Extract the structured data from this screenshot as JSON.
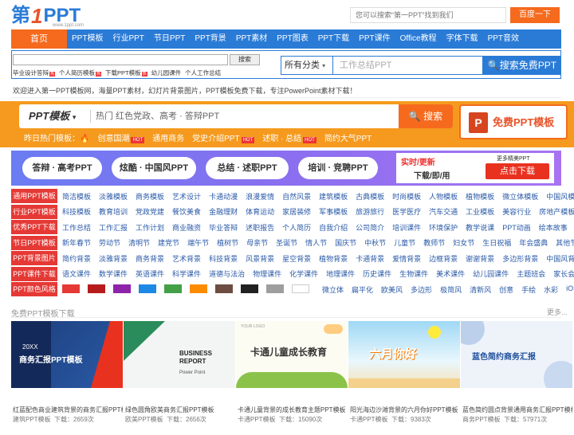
{
  "header": {
    "logo_part1": "第",
    "logo_part2": "1",
    "logo_part3": "PPT",
    "logo_sub": "www.1ppt.com",
    "search_placeholder": "您可以搜索“第一PPT”找到我们",
    "search_button": "百度一下"
  },
  "nav": {
    "home": "首页",
    "items": [
      "PPT模板",
      "行业PPT",
      "节日PPT",
      "PPT背景",
      "PPT素材",
      "PPT图表",
      "PPT下载",
      "PPT课件",
      "Office教程",
      "字体下载",
      "PPT音效"
    ]
  },
  "subsearch": {
    "button": "搜索",
    "hot_links": [
      "毕业设计答辩",
      "个人简历模板",
      "下载PPT模板",
      "幼儿园课件",
      "个人工作总结"
    ],
    "hot_tag": "热"
  },
  "mainsearch": {
    "category": "所有分类",
    "placeholder": "工作总结PPT",
    "button": "搜索免费PPT"
  },
  "welcome": "欢迎进入第一PPT模板网，海量PPT素材，幻灯片背景图片，PPT模板免费下载，专注PowerPoint素材下载！",
  "orange_search": {
    "label": "PPT模板",
    "placeholder": "热门 红色党政、高考 · 答辩PPT",
    "button": "搜索",
    "free_button": "免费PPT模板",
    "free_icon": "P"
  },
  "hot_line": {
    "label": "昨日热门模板：",
    "items": [
      {
        "text": "创意国潮",
        "hot": true
      },
      {
        "text": "通用商务",
        "hot": false
      },
      {
        "text": "党史介绍PPT",
        "hot": true
      },
      {
        "text": "述职 · 总结",
        "hot": true
      },
      {
        "text": "简约大气PPT",
        "hot": false
      }
    ],
    "hot_tag": "HOT"
  },
  "pills": [
    "答辩 · 高考PPT",
    "炫酷 · 中国风PPT",
    "总结 · 述职PPT",
    "培训 · 竞聘PPT"
  ],
  "promo": {
    "line1": "实时/更新",
    "line2": "下载/即/用",
    "more": "更多精美PPT",
    "button": "点击下载"
  },
  "grid": [
    {
      "label": "通用PPT模板",
      "items": [
        "简洁模板",
        "淡雅模板",
        "商务模板",
        "艺术设计",
        "卡通动漫",
        "浪漫爱情",
        "自然风景",
        "建筑模板",
        "古典模板",
        "时尚模板",
        "人物模板",
        "植物模板",
        "微立体模板",
        "中国风模板"
      ]
    },
    {
      "label": "行业PPT模板",
      "items": [
        "科技模板",
        "教育培训",
        "党政党建",
        "餐饮美食",
        "金融理财",
        "体育运动",
        "家居装修",
        "军事模板",
        "旅游旅行",
        "医学医疗",
        "汽车交通",
        "工业模板",
        "美容行业",
        "房地产模板"
      ]
    },
    {
      "label": "优秀PPT下载",
      "items": [
        "工作总结",
        "工作汇报",
        "工作计划",
        "商业融资",
        "毕业答辩",
        "述职报告",
        "个人简历",
        "自我介绍",
        "公司简介",
        "培训课件",
        "环境保护",
        "教学说课",
        "PPT动画",
        "绘本故事"
      ]
    },
    {
      "label": "节日PPT模板",
      "items": [
        "新年春节",
        "劳动节",
        "清明节",
        "建党节",
        "端午节",
        "植树节",
        "母亲节",
        "圣诞节",
        "情人节",
        "国庆节",
        "中秋节",
        "儿童节",
        "教师节",
        "妇女节",
        "生日祝福",
        "年会盛典",
        "其他节日"
      ]
    },
    {
      "label": "PPT背景图片",
      "items": [
        "简约背景",
        "淡雅背景",
        "商务背景",
        "艺术背景",
        "科技背景",
        "风景背景",
        "星空背景",
        "植物背景",
        "卡通背景",
        "爱情背景",
        "边框背景",
        "谢谢背景",
        "多边形背景",
        "中国风背景"
      ]
    },
    {
      "label": "PPT课件下载",
      "items": [
        "语文课件",
        "数学课件",
        "英语课件",
        "科学课件",
        "道德与法治",
        "物理课件",
        "化学课件",
        "地理课件",
        "历史课件",
        "生物课件",
        "美术课件",
        "幼儿园课件",
        "主题班会",
        "家长会"
      ]
    },
    {
      "label": "PPT颜色风格",
      "items": [
        "微立体",
        "扁平化",
        "欧美风",
        "多边形",
        "极简风",
        "清新风",
        "创意",
        "手绘",
        "水彩",
        "iOS"
      ]
    }
  ],
  "swatches": [
    "#e53935",
    "#b71c1c",
    "#8e24aa",
    "#1e88e5",
    "#43a047",
    "#fb8c00",
    "#6d4c41",
    "#212121",
    "#9e9e9e",
    "#ffffff"
  ],
  "free_section": {
    "title": "免费PPT模板下载",
    "more": "更多..."
  },
  "cards": [
    {
      "title": "红蓝配色商业建筑背景的商务汇报PPT模板",
      "cat": "建筑PPT模板",
      "downloads": "下载：2659次",
      "img_text": "商务汇报PPT模板",
      "img_sub": "20XX"
    },
    {
      "title": "绿色圆角欧美商务汇报PPT模板",
      "cat": "欧美PPT模板",
      "downloads": "下载：2656次",
      "img_text": "BUSINESS REPORT",
      "img_sub": "Power Point"
    },
    {
      "title": "卡通儿童背景的成长教育主题PPT模板",
      "cat": "卡通PPT模板",
      "downloads": "下载：15090次",
      "img_text": "卡通儿童成长教育",
      "img_sub": "YOUR LOGO"
    },
    {
      "title": "阳光海边沙滩背景的六月你好PPT模板",
      "cat": "卡通PPT模板",
      "downloads": "下载：9383次",
      "img_text": "六月你好",
      "img_sub": ""
    },
    {
      "title": "蓝色简约圆点背景通用商务汇报PPT模板",
      "cat": "商务PPT模板",
      "downloads": "下载：57971次",
      "img_text": "蓝色简约商务汇报",
      "img_sub": ""
    }
  ]
}
